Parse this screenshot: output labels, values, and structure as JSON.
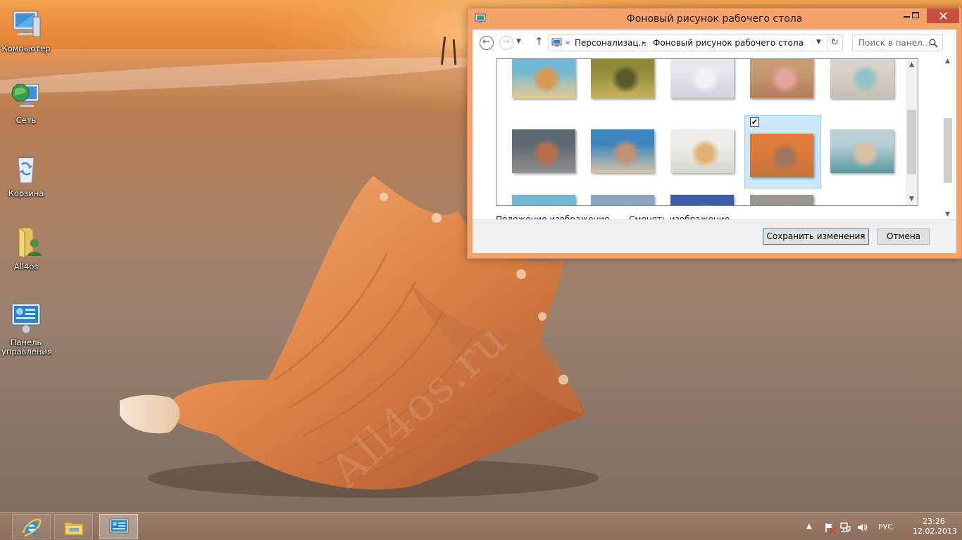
{
  "desktop": {
    "watermark": "All4os.ru",
    "icons": [
      {
        "label": "Компьютер",
        "icon": "computer-icon"
      },
      {
        "label": "Сеть",
        "icon": "network-icon"
      },
      {
        "label": "Корзина",
        "icon": "recycle-bin-icon"
      },
      {
        "label": "All4os",
        "icon": "user-folder-icon"
      },
      {
        "label": "Панель управления",
        "icon": "control-panel-icon"
      }
    ]
  },
  "window": {
    "title": "Фоновый рисунок рабочего стола",
    "address": {
      "overflow": "«",
      "crumbs": [
        "Персонализац...",
        "Фоновый рисунок рабочего стола"
      ],
      "separator": "►"
    },
    "search": {
      "placeholder": "Поиск в панел..."
    },
    "gallery": {
      "selected_index": 8,
      "selected_checked": true,
      "thumbnails": [
        {
          "name": "starfish-shells",
          "colors": [
            "#6fb8d8",
            "#e9c98e",
            "#d69a52"
          ]
        },
        {
          "name": "golden-shells",
          "colors": [
            "#8e8a3a",
            "#c9b35a",
            "#5b5a2a"
          ]
        },
        {
          "name": "pastel-shells",
          "colors": [
            "#e9e6ef",
            "#d4d0dd",
            "#f4f0f4"
          ]
        },
        {
          "name": "pink-shell-sand",
          "colors": [
            "#c79a72",
            "#b37f5c",
            "#e3a3a0"
          ]
        },
        {
          "name": "white-shells-sand",
          "colors": [
            "#d9d2c8",
            "#c8bfb3",
            "#8fc4c9"
          ]
        },
        {
          "name": "shells-on-beach",
          "colors": [
            "#5c6a74",
            "#8f8f8c",
            "#b86f4d"
          ]
        },
        {
          "name": "conch-on-ocean",
          "colors": [
            "#3f86c0",
            "#d7c3a5",
            "#c39272"
          ]
        },
        {
          "name": "white-sand-starfish",
          "colors": [
            "#efede9",
            "#d9d5cf",
            "#e0b172"
          ]
        },
        {
          "name": "conch-sunset",
          "colors": [
            "#e07a38",
            "#c4733e",
            "#9e7561"
          ]
        },
        {
          "name": "conch-surf",
          "colors": [
            "#b7cfd4",
            "#5a9aa3",
            "#d9c0a5"
          ]
        },
        {
          "name": "turquoise-sea",
          "colors": [
            "#6fb8d8",
            "#9fd2e4",
            "#ffffff"
          ]
        },
        {
          "name": "blue-pebbles",
          "colors": [
            "#8aa7c0",
            "#c7d4df",
            "#ffffff"
          ]
        },
        {
          "name": "deep-blue",
          "colors": [
            "#3b5ea8",
            "#6886c4",
            "#ffffff"
          ]
        },
        {
          "name": "grey-sand",
          "colors": [
            "#9b958d",
            "#bcb5ab",
            "#ffffff"
          ]
        }
      ]
    },
    "options": {
      "position_label": "Положение изображения",
      "change_label": "Сменять изображение"
    },
    "buttons": {
      "save": "Сохранить изменения",
      "cancel": "Отмена"
    }
  },
  "taskbar": {
    "apps": [
      {
        "name": "internet-explorer",
        "icon": "ie-icon",
        "active": false
      },
      {
        "name": "file-explorer",
        "icon": "folder-icon",
        "active": false
      },
      {
        "name": "control-panel",
        "icon": "control-panel-icon",
        "active": true
      }
    ],
    "tray": {
      "language": "РУС",
      "time": "23:26",
      "date": "12.02.2013"
    }
  },
  "colors": {
    "window_frame": "#f5a36a",
    "selection_fill": "#cce8ff",
    "selection_border": "#99d1ff",
    "close_button": "#c7503f",
    "taskbar": "#8c705d"
  }
}
